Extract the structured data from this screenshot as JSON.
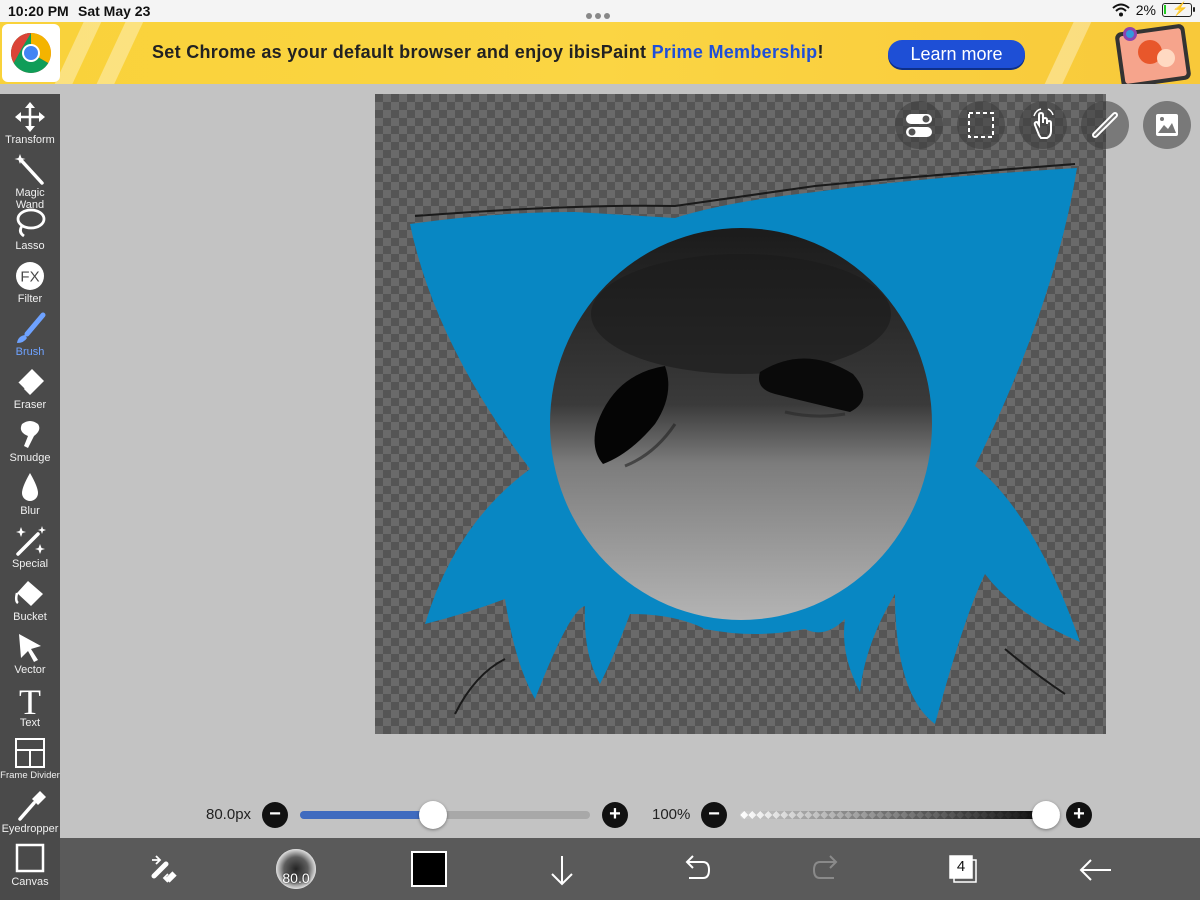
{
  "status_bar": {
    "time": "10:20 PM",
    "date": "Sat May 23",
    "battery": "2%",
    "battery_level": 0.02
  },
  "banner": {
    "message_prefix": "Set Chrome as your default browser and enjoy ibisPaint ",
    "message_highlight": "Prime Membership",
    "message_suffix": "!",
    "button_label": "Learn more",
    "accent_color": "#1e4fd6",
    "background_color": "#f9d23a"
  },
  "toolbar": {
    "tools": [
      {
        "label": "Transform",
        "icon": "move-arrows-icon"
      },
      {
        "label": "Magic Wand",
        "icon": "magic-wand-icon"
      },
      {
        "label": "Lasso",
        "icon": "lasso-icon"
      },
      {
        "label": "Filter",
        "icon": "fx-filter-icon"
      },
      {
        "label": "Brush",
        "icon": "brush-icon"
      },
      {
        "label": "Eraser",
        "icon": "eraser-icon"
      },
      {
        "label": "Smudge",
        "icon": "smudge-icon"
      },
      {
        "label": "Blur",
        "icon": "blur-drop-icon"
      },
      {
        "label": "Special",
        "icon": "sparkle-icon"
      },
      {
        "label": "Bucket",
        "icon": "bucket-icon"
      },
      {
        "label": "Vector",
        "icon": "cursor-arrow-icon"
      },
      {
        "label": "Text",
        "icon": "text-t-icon"
      },
      {
        "label": "Frame Divider",
        "icon": "frame-divider-icon"
      },
      {
        "label": "Eyedropper",
        "icon": "eyedropper-icon"
      },
      {
        "label": "Canvas",
        "icon": "canvas-square-icon"
      }
    ],
    "active_tool": "Brush",
    "active_color": "#6ea2ff"
  },
  "canvas_controls": [
    "toggle-switches-icon",
    "selection-marquee-icon",
    "hand-touch-icon",
    "ruler-icon",
    "reference-image-icon"
  ],
  "brush": {
    "size_label": "80.0px",
    "size_fraction": 0.46,
    "opacity_label": "100%",
    "opacity_fraction": 1.0,
    "size_track_color": "#3f6bbf"
  },
  "bottom_bar": {
    "brush_preview_label": "80.0",
    "current_color": "#000000",
    "layer_count": "4",
    "buttons": [
      "swap-tools-icon",
      "brush-preview",
      "color-swatch",
      "download-arrow-icon",
      "undo-icon",
      "redo-icon",
      "layers-icon",
      "back-arrow-icon"
    ]
  },
  "artwork": {
    "hair_color": "#0887c3",
    "face_color": "#1e1e1e"
  }
}
